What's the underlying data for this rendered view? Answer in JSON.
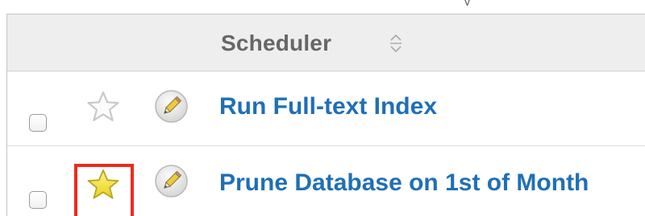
{
  "page_top_fragment": "y",
  "table": {
    "header": {
      "column_label": "Scheduler",
      "sort_icon": "sort-up-down-icon"
    },
    "rows": [
      {
        "name": "Run Full-text Index",
        "favorite": false,
        "checked": false,
        "star_icon": "star-outline-icon",
        "edit_icon": "pencil-edit-icon"
      },
      {
        "name": "Prune Database on 1st of Month",
        "favorite": true,
        "checked": false,
        "star_icon": "star-filled-icon",
        "edit_icon": "pencil-edit-icon",
        "highlighted": true
      }
    ]
  },
  "colors": {
    "link": "#1f6fb7",
    "header_bg": "#eeeeee",
    "header_text": "#666666",
    "star_outline": "#d3d3d3",
    "star_filled": "#f0df20",
    "highlight": "#ee2b1d"
  }
}
